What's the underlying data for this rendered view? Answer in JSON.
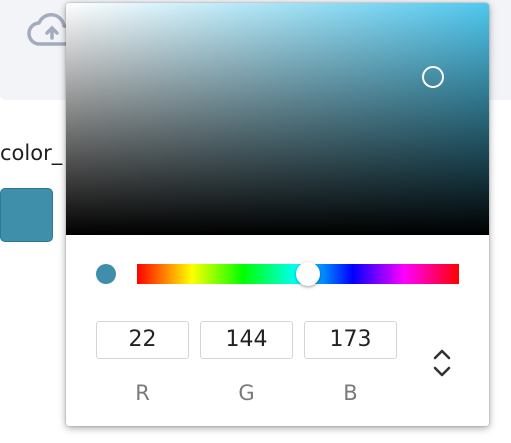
{
  "background": {
    "field_label": "color_",
    "swatch_color": "#3f8faa",
    "upload_icon": "cloud-upload-icon"
  },
  "picker": {
    "hue_color": "#4fc8ef",
    "current_color": "#3f8faa",
    "hue_fraction": 0.53,
    "sv_icon": "circle-cursor-icon",
    "mode_icon": "chevron-up-down-icon",
    "r": {
      "value": "22",
      "label": "R"
    },
    "g": {
      "value": "144",
      "label": "G"
    },
    "b": {
      "value": "173",
      "label": "B"
    }
  }
}
